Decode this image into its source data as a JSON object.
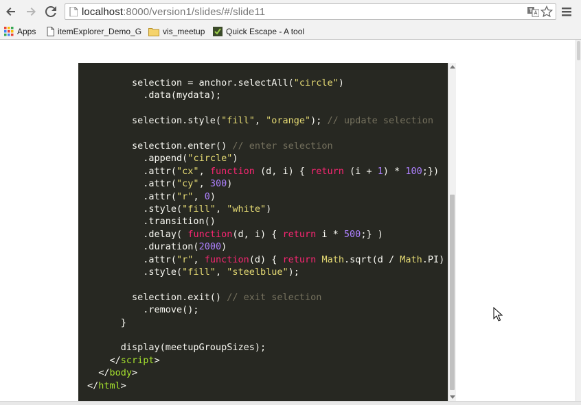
{
  "browser": {
    "url_host": "localhost",
    "url_path": ":8000/version1/slides/#/slide11"
  },
  "bookmarks": [
    {
      "label": "Apps",
      "icon": "apps-grid-icon"
    },
    {
      "label": "itemExplorer_Demo_G",
      "icon": "page-icon"
    },
    {
      "label": "vis_meetup",
      "icon": "folder-icon"
    },
    {
      "label": "Quick Escape - A tool",
      "icon": "quick-escape-icon"
    }
  ],
  "code": {
    "lines": [
      [
        {
          "t": "        selection = anchor.selectAll(",
          "c": "pl"
        },
        {
          "t": "\"circle\"",
          "c": "sc"
        },
        {
          "t": ")",
          "c": "pl"
        }
      ],
      [
        {
          "t": "          .data(mydata);",
          "c": "pl"
        }
      ],
      [],
      [
        {
          "t": "        selection.style(",
          "c": "pl"
        },
        {
          "t": "\"fill\"",
          "c": "sc"
        },
        {
          "t": ", ",
          "c": "pl"
        },
        {
          "t": "\"orange\"",
          "c": "sc"
        },
        {
          "t": "); ",
          "c": "pl"
        },
        {
          "t": "// update selection",
          "c": "cm"
        }
      ],
      [],
      [
        {
          "t": "        selection.enter() ",
          "c": "pl"
        },
        {
          "t": "// enter selection",
          "c": "cm"
        }
      ],
      [
        {
          "t": "          .append(",
          "c": "pl"
        },
        {
          "t": "\"circle\"",
          "c": "sc"
        },
        {
          "t": ")",
          "c": "pl"
        }
      ],
      [
        {
          "t": "          .attr(",
          "c": "pl"
        },
        {
          "t": "\"cx\"",
          "c": "sc"
        },
        {
          "t": ", ",
          "c": "pl"
        },
        {
          "t": "function",
          "c": "kw"
        },
        {
          "t": " (d, i) { ",
          "c": "pl"
        },
        {
          "t": "return",
          "c": "kw"
        },
        {
          "t": " (i + ",
          "c": "pl"
        },
        {
          "t": "1",
          "c": "nm"
        },
        {
          "t": ") * ",
          "c": "pl"
        },
        {
          "t": "100",
          "c": "nm"
        },
        {
          "t": ";})",
          "c": "pl"
        }
      ],
      [
        {
          "t": "          .attr(",
          "c": "pl"
        },
        {
          "t": "\"cy\"",
          "c": "sc"
        },
        {
          "t": ", ",
          "c": "pl"
        },
        {
          "t": "300",
          "c": "nm"
        },
        {
          "t": ")",
          "c": "pl"
        }
      ],
      [
        {
          "t": "          .attr(",
          "c": "pl"
        },
        {
          "t": "\"r\"",
          "c": "sc"
        },
        {
          "t": ", ",
          "c": "pl"
        },
        {
          "t": "0",
          "c": "nm"
        },
        {
          "t": ")",
          "c": "pl"
        }
      ],
      [
        {
          "t": "          .style(",
          "c": "pl"
        },
        {
          "t": "\"fill\"",
          "c": "sc"
        },
        {
          "t": ", ",
          "c": "pl"
        },
        {
          "t": "\"white\"",
          "c": "sc"
        },
        {
          "t": ")",
          "c": "pl"
        }
      ],
      [
        {
          "t": "          .transition()",
          "c": "pl"
        }
      ],
      [
        {
          "t": "          .delay( ",
          "c": "pl"
        },
        {
          "t": "function",
          "c": "kw"
        },
        {
          "t": "(d, i) { ",
          "c": "pl"
        },
        {
          "t": "return",
          "c": "kw"
        },
        {
          "t": " i * ",
          "c": "pl"
        },
        {
          "t": "500",
          "c": "nm"
        },
        {
          "t": ";} )",
          "c": "pl"
        }
      ],
      [
        {
          "t": "          .duration(",
          "c": "pl"
        },
        {
          "t": "2000",
          "c": "nm"
        },
        {
          "t": ")",
          "c": "pl"
        }
      ],
      [
        {
          "t": "          .attr(",
          "c": "pl"
        },
        {
          "t": "\"r\"",
          "c": "sc"
        },
        {
          "t": ", ",
          "c": "pl"
        },
        {
          "t": "function",
          "c": "kw"
        },
        {
          "t": "(d) { ",
          "c": "pl"
        },
        {
          "t": "return",
          "c": "kw"
        },
        {
          "t": " ",
          "c": "pl"
        },
        {
          "t": "Math",
          "c": "sc"
        },
        {
          "t": ".sqrt(d / ",
          "c": "pl"
        },
        {
          "t": "Math",
          "c": "sc"
        },
        {
          "t": ".PI)",
          "c": "pl"
        }
      ],
      [
        {
          "t": "          .style(",
          "c": "pl"
        },
        {
          "t": "\"fill\"",
          "c": "sc"
        },
        {
          "t": ", ",
          "c": "pl"
        },
        {
          "t": "\"steelblue\"",
          "c": "sc"
        },
        {
          "t": ");",
          "c": "pl"
        }
      ],
      [],
      [
        {
          "t": "        selection.exit() ",
          "c": "pl"
        },
        {
          "t": "// exit selection",
          "c": "cm"
        }
      ],
      [
        {
          "t": "          .remove();",
          "c": "pl"
        }
      ],
      [
        {
          "t": "      }",
          "c": "pl"
        }
      ],
      [],
      [
        {
          "t": "      display(meetupGroupSizes);",
          "c": "pl"
        }
      ],
      [
        {
          "t": "    </",
          "c": "pl"
        },
        {
          "t": "script",
          "c": "tg"
        },
        {
          "t": ">",
          "c": "pl"
        }
      ],
      [
        {
          "t": "  </",
          "c": "pl"
        },
        {
          "t": "body",
          "c": "tg"
        },
        {
          "t": ">",
          "c": "pl"
        }
      ],
      [
        {
          "t": "</",
          "c": "pl"
        },
        {
          "t": "html",
          "c": "tg"
        },
        {
          "t": ">",
          "c": "pl"
        }
      ]
    ]
  }
}
